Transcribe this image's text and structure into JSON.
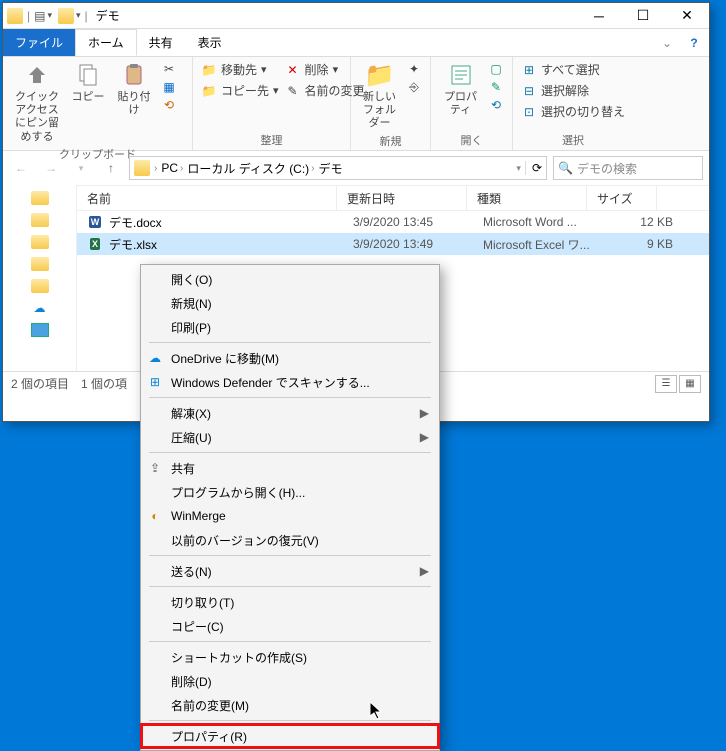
{
  "window": {
    "title": "デモ",
    "menu": {
      "file": "ファイル",
      "home": "ホーム",
      "share": "共有",
      "view": "表示"
    },
    "help_icon": "?"
  },
  "ribbon": {
    "clipboard": {
      "title": "クリップボード",
      "pin": "クイック アクセス\nにピン留めする",
      "copy": "コピー",
      "paste": "貼り付け",
      "cut": "切り取り",
      "copypath": "パスのコピー",
      "pasteshortcut": "ショートカットの貼り付け"
    },
    "organize": {
      "title": "整理",
      "moveto": "移動先",
      "copyto": "コピー先",
      "delete": "削除",
      "rename": "名前の変更"
    },
    "new": {
      "title": "新規",
      "newfolder": "新しい\nフォルダー",
      "newitem": "新しいアイテム",
      "easyaccess": "ショートカット"
    },
    "open": {
      "title": "開く",
      "properties": "プロパティ",
      "open": "開く",
      "edit": "編集",
      "history": "履歴"
    },
    "select": {
      "title": "選択",
      "selectall": "すべて選択",
      "selectnone": "選択解除",
      "invert": "選択の切り替え"
    }
  },
  "breadcrumb": {
    "pc": "PC",
    "c": "ローカル ディスク (C:)",
    "demo": "デモ"
  },
  "search": {
    "placeholder": "デモの検索"
  },
  "columns": {
    "name": "名前",
    "date": "更新日時",
    "type": "種類",
    "size": "サイズ"
  },
  "files": [
    {
      "name": "デモ.docx",
      "date": "3/9/2020 13:45",
      "type": "Microsoft Word ...",
      "size": "12 KB",
      "icon": "word"
    },
    {
      "name": "デモ.xlsx",
      "date": "3/9/2020 13:49",
      "type": "Microsoft Excel ワ...",
      "size": "9 KB",
      "icon": "excel",
      "selected": true
    }
  ],
  "status": {
    "items": "2 個の項目",
    "selected": "1 個の項"
  },
  "context_menu": [
    {
      "label": "開く(O)"
    },
    {
      "label": "新規(N)"
    },
    {
      "label": "印刷(P)"
    },
    {
      "sep": true
    },
    {
      "label": "OneDrive に移動(M)",
      "icon": "onedrive"
    },
    {
      "label": "Windows Defender でスキャンする...",
      "icon": "defender"
    },
    {
      "sep": true
    },
    {
      "label": "解凍(X)",
      "arrow": true
    },
    {
      "label": "圧縮(U)",
      "arrow": true
    },
    {
      "sep": true
    },
    {
      "label": "共有",
      "icon": "share"
    },
    {
      "label": "プログラムから開く(H)..."
    },
    {
      "label": "WinMerge",
      "icon": "winmerge"
    },
    {
      "label": "以前のバージョンの復元(V)"
    },
    {
      "sep": true
    },
    {
      "label": "送る(N)",
      "arrow": true
    },
    {
      "sep": true
    },
    {
      "label": "切り取り(T)"
    },
    {
      "label": "コピー(C)"
    },
    {
      "sep": true
    },
    {
      "label": "ショートカットの作成(S)"
    },
    {
      "label": "削除(D)"
    },
    {
      "label": "名前の変更(M)"
    },
    {
      "sep": true
    },
    {
      "label": "プロパティ(R)",
      "highlight": true
    }
  ]
}
